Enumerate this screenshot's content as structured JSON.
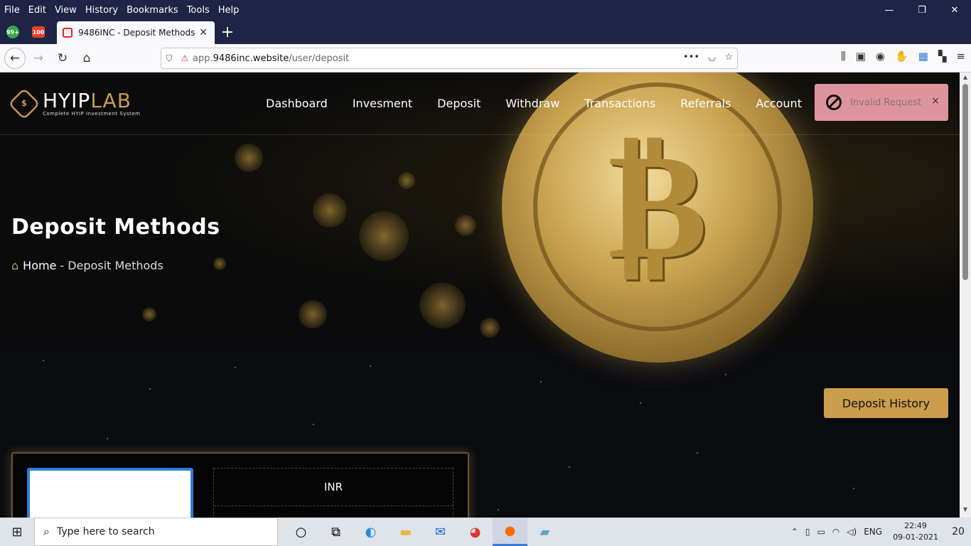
{
  "browser": {
    "menu": [
      "File",
      "Edit",
      "View",
      "History",
      "Bookmarks",
      "Tools",
      "Help"
    ],
    "window_controls": {
      "minimize": "—",
      "restore": "❐",
      "close": "✕"
    },
    "pinned_tabs": [
      {
        "icon": "chat-badge-icon",
        "label": "99+"
      },
      {
        "icon": "app-icon",
        "label": "100"
      }
    ],
    "tab": {
      "title": "9486INC - Deposit Methods",
      "close": "✕"
    },
    "new_tab": "+",
    "url": {
      "prefix": "app.",
      "host": "9486inc.website",
      "path": "/user/deposit"
    },
    "url_actions": {
      "more": "•••",
      "pocket": "◡",
      "bookmark": "☆"
    }
  },
  "site": {
    "logo": {
      "main": "HYIP",
      "accent": "LAB",
      "tagline": "Complete HYIP Investment System",
      "icon_glyph": "$"
    },
    "nav": [
      "Dashboard",
      "Invesment",
      "Deposit",
      "Withdraw",
      "Transactions",
      "Referrals",
      "Account"
    ],
    "toast": {
      "message": "Invalid Request",
      "close": "×"
    },
    "page_title": "Deposit Methods",
    "breadcrumb": {
      "home": "Home",
      "separator": "-",
      "current": "Deposit Methods"
    },
    "deposit_history_button": "Deposit History",
    "method_card": {
      "currency": "INR"
    },
    "accent_color": "#c99d4c"
  },
  "taskbar": {
    "search_placeholder": "Type here to search",
    "tray_language": "ENG",
    "time": "22:49",
    "date": "09-01-2021",
    "notification_count": "20"
  }
}
